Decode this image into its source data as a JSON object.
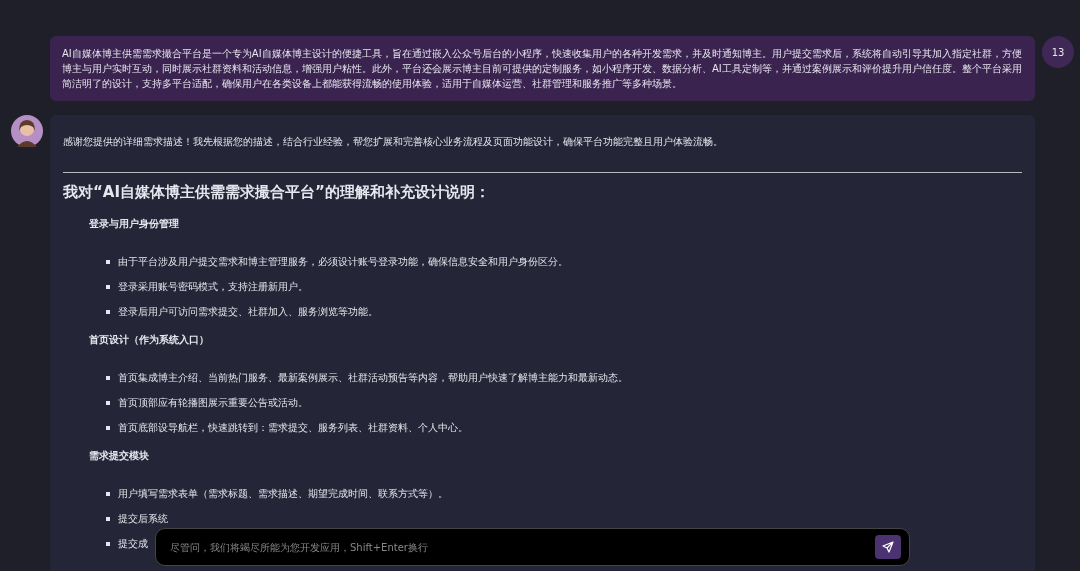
{
  "user_message": {
    "text": "AI自媒体博主供需需求撮合平台是一个专为AI自媒体博主设计的便捷工具，旨在通过嵌入公众号后台的小程序，快速收集用户的各种开发需求，并及时通知博主。用户提交需求后，系统将自动引导其加入指定社群，方便博主与用户实时互动，同时展示社群资料和活动信息，增强用户粘性。此外，平台还会展示博主目前可提供的定制服务，如小程序开发、数据分析、AI工具定制等，并通过案例展示和评价提升用户信任度。整个平台采用简洁明了的设计，支持多平台适配，确保用户在各类设备上都能获得流畅的使用体验，适用于自媒体运营、社群管理和服务推广等多种场景。",
    "badge": "13"
  },
  "assistant_message": {
    "intro": "感谢您提供的详细需求描述！我先根据您的描述，结合行业经验，帮您扩展和完善核心业务流程及页面功能设计，确保平台功能完整且用户体验流畅。",
    "heading": "我对“AI自媒体博主供需需求撮合平台”的理解和补充设计说明：",
    "sections": [
      {
        "title": "登录与用户身份管理",
        "bullets": [
          "由于平台涉及用户提交需求和博主管理服务，必须设计账号登录功能，确保信息安全和用户身份区分。",
          "登录采用账号密码模式，支持注册新用户。",
          "登录后用户可访问需求提交、社群加入、服务浏览等功能。"
        ]
      },
      {
        "title": "首页设计（作为系统入口）",
        "bullets": [
          "首页集成博主介绍、当前热门服务、最新案例展示、社群活动预告等内容，帮助用户快速了解博主能力和最新动态。",
          "首页顶部应有轮播图展示重要公告或活动。",
          "首页底部设导航栏，快速跳转到：需求提交、服务列表、社群资料、个人中心。"
        ]
      },
      {
        "title": "需求提交模块",
        "bullets": [
          "用户填写需求表单（需求标题、需求描述、期望完成时间、联系方式等）。",
          "提交后系统",
          "提交成"
        ]
      }
    ]
  },
  "input": {
    "placeholder": "尽管问，我们将竭尽所能为您开发应用，Shift+Enter换行"
  }
}
